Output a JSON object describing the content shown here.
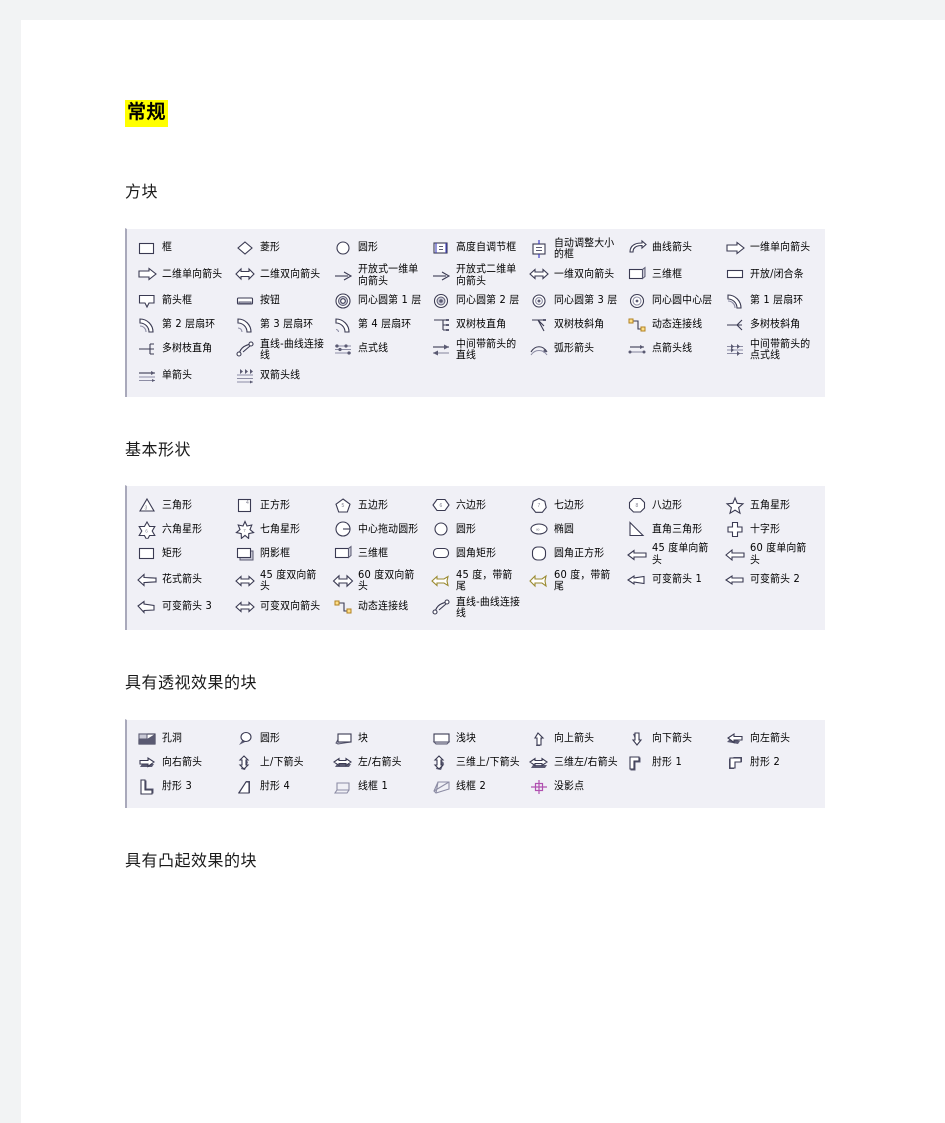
{
  "document": {
    "title": "常规",
    "sections": [
      {
        "heading": "方块",
        "panel_name": "blocks-stencil",
        "items": [
          {
            "label": "框",
            "icon": "rectangle-icon"
          },
          {
            "label": "菱形",
            "icon": "diamond-icon"
          },
          {
            "label": "圆形",
            "icon": "circle-icon"
          },
          {
            "label": "高度自调节框",
            "icon": "height-auto-box-icon"
          },
          {
            "label": "自动调整大小的框",
            "icon": "auto-resize-box-icon"
          },
          {
            "label": "曲线箭头",
            "icon": "curved-arrow-icon"
          },
          {
            "label": "一维单向箭头",
            "icon": "1d-single-arrow-icon"
          },
          {
            "label": "二维单向箭头",
            "icon": "2d-single-arrow-icon"
          },
          {
            "label": "二维双向箭头",
            "icon": "2d-double-arrow-icon"
          },
          {
            "label": "开放式一维单向箭头",
            "icon": "open-1d-single-arrow-icon"
          },
          {
            "label": "开放式二维单向箭头",
            "icon": "open-2d-single-arrow-icon"
          },
          {
            "label": "一维双向箭头",
            "icon": "1d-double-arrow-icon"
          },
          {
            "label": "三维框",
            "icon": "3d-box-icon"
          },
          {
            "label": "开放/闭合条",
            "icon": "open-close-bar-icon"
          },
          {
            "label": "箭头框",
            "icon": "arrow-box-icon"
          },
          {
            "label": "按钮",
            "icon": "button-icon"
          },
          {
            "label": "同心圆第 1 层",
            "icon": "concentric-circle-layer1-icon"
          },
          {
            "label": "同心圆第 2 层",
            "icon": "concentric-circle-layer2-icon"
          },
          {
            "label": "同心圆第 3 层",
            "icon": "concentric-circle-layer3-icon"
          },
          {
            "label": "同心圆中心层",
            "icon": "concentric-circle-center-icon"
          },
          {
            "label": "第 1 层扇环",
            "icon": "annulus-sector1-icon"
          },
          {
            "label": "第 2 层扇环",
            "icon": "annulus-sector2-icon"
          },
          {
            "label": "第 3 层扇环",
            "icon": "annulus-sector3-icon"
          },
          {
            "label": "第 4 层扇环",
            "icon": "annulus-sector4-icon"
          },
          {
            "label": "双树枝直角",
            "icon": "double-branch-right-angle-icon"
          },
          {
            "label": "双树枝斜角",
            "icon": "double-branch-oblique-icon"
          },
          {
            "label": "动态连接线",
            "icon": "dynamic-connector-icon"
          },
          {
            "label": "多树枝斜角",
            "icon": "multi-branch-oblique-icon"
          },
          {
            "label": "多树枝直角",
            "icon": "multi-branch-right-angle-icon"
          },
          {
            "label": "直线-曲线连接线",
            "icon": "line-curve-connector-icon"
          },
          {
            "label": "点式线",
            "icon": "dotted-line-icon"
          },
          {
            "label": "中间带箭头的直线",
            "icon": "center-arrow-line-icon"
          },
          {
            "label": "弧形箭头",
            "icon": "arc-arrow-icon"
          },
          {
            "label": "点箭头线",
            "icon": "dot-arrow-line-icon"
          },
          {
            "label": "中间带箭头的点式线",
            "icon": "center-arrow-dotted-line-icon"
          },
          {
            "label": "单箭头",
            "icon": "single-arrow-icon"
          },
          {
            "label": "双箭头线",
            "icon": "double-arrow-line-icon"
          }
        ]
      },
      {
        "heading": "基本形状",
        "panel_name": "basic-shapes-stencil",
        "items": [
          {
            "label": "三角形",
            "icon": "triangle-icon"
          },
          {
            "label": "正方形",
            "icon": "square-icon"
          },
          {
            "label": "五边形",
            "icon": "pentagon-icon"
          },
          {
            "label": "六边形",
            "icon": "hexagon-icon"
          },
          {
            "label": "七边形",
            "icon": "heptagon-icon"
          },
          {
            "label": "八边形",
            "icon": "octagon-icon"
          },
          {
            "label": "五角星形",
            "icon": "five-point-star-icon"
          },
          {
            "label": "六角星形",
            "icon": "six-point-star-icon"
          },
          {
            "label": "七角星形",
            "icon": "seven-point-star-icon"
          },
          {
            "label": "中心拖动圆形",
            "icon": "center-drag-circle-icon"
          },
          {
            "label": "圆形",
            "icon": "circle-icon"
          },
          {
            "label": "椭圆",
            "icon": "ellipse-icon"
          },
          {
            "label": "直角三角形",
            "icon": "right-triangle-icon"
          },
          {
            "label": "十字形",
            "icon": "cross-icon"
          },
          {
            "label": "矩形",
            "icon": "rectangle-icon"
          },
          {
            "label": "阴影框",
            "icon": "shadow-box-icon"
          },
          {
            "label": "三维框",
            "icon": "3d-box-icon"
          },
          {
            "label": "圆角矩形",
            "icon": "rounded-rect-icon"
          },
          {
            "label": "圆角正方形",
            "icon": "rounded-square-icon"
          },
          {
            "label": "45 度单向箭头",
            "icon": "45-deg-single-arrow-icon"
          },
          {
            "label": "60 度单向箭头",
            "icon": "60-deg-single-arrow-icon"
          },
          {
            "label": "花式箭头",
            "icon": "fancy-arrow-icon"
          },
          {
            "label": "45 度双向箭头",
            "icon": "45-deg-double-arrow-icon"
          },
          {
            "label": "60 度双向箭头",
            "icon": "60-deg-double-arrow-icon"
          },
          {
            "label": "45 度，带箭尾",
            "icon": "45-deg-arrow-tail-icon"
          },
          {
            "label": "60 度，带箭尾",
            "icon": "60-deg-arrow-tail-icon"
          },
          {
            "label": "可变箭头 1",
            "icon": "variable-arrow-1-icon"
          },
          {
            "label": "可变箭头 2",
            "icon": "variable-arrow-2-icon"
          },
          {
            "label": "可变箭头 3",
            "icon": "variable-arrow-3-icon"
          },
          {
            "label": "可变双向箭头",
            "icon": "variable-double-arrow-icon"
          },
          {
            "label": "动态连接线",
            "icon": "dynamic-connector-icon"
          },
          {
            "label": "直线-曲线连接线",
            "icon": "line-curve-connector-icon"
          }
        ]
      },
      {
        "heading": "具有透视效果的块",
        "panel_name": "perspective-blocks-stencil",
        "items": [
          {
            "label": "孔洞",
            "icon": "hole-icon"
          },
          {
            "label": "圆形",
            "icon": "perspective-circle-icon"
          },
          {
            "label": "块",
            "icon": "perspective-block-icon"
          },
          {
            "label": "浅块",
            "icon": "shallow-block-icon"
          },
          {
            "label": "向上箭头",
            "icon": "up-arrow-icon"
          },
          {
            "label": "向下箭头",
            "icon": "down-arrow-icon"
          },
          {
            "label": "向左箭头",
            "icon": "left-arrow-icon"
          },
          {
            "label": "向右箭头",
            "icon": "right-arrow-icon"
          },
          {
            "label": "上/下箭头",
            "icon": "up-down-arrow-icon"
          },
          {
            "label": "左/右箭头",
            "icon": "left-right-arrow-icon"
          },
          {
            "label": "三维上/下箭头",
            "icon": "3d-up-down-arrow-icon"
          },
          {
            "label": "三维左/右箭头",
            "icon": "3d-left-right-arrow-icon"
          },
          {
            "label": "肘形 1",
            "icon": "elbow-1-icon"
          },
          {
            "label": "肘形 2",
            "icon": "elbow-2-icon"
          },
          {
            "label": "肘形 3",
            "icon": "elbow-3-icon"
          },
          {
            "label": "肘形 4",
            "icon": "elbow-4-icon"
          },
          {
            "label": "线框 1",
            "icon": "wireframe-1-icon"
          },
          {
            "label": "线框 2",
            "icon": "wireframe-2-icon"
          },
          {
            "label": "没影点",
            "icon": "vanishing-point-icon"
          }
        ]
      },
      {
        "heading": "具有凸起效果的块",
        "panel_name": "raised-blocks-stencil",
        "items": []
      }
    ]
  }
}
